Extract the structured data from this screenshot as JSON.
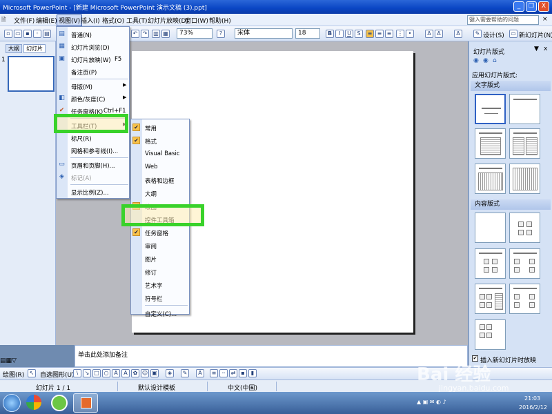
{
  "window": {
    "title": "Microsoft PowerPoint - [新建 Microsoft PowerPoint 演示文稿 (3).ppt]",
    "minimize_label": "_",
    "restore_label": "❐",
    "close_label": "X"
  },
  "menubar": {
    "items": [
      "文件(F)",
      "编辑(E)",
      "视图(V)",
      "插入(I)",
      "格式(O)",
      "工具(T)",
      "幻灯片放映(D)",
      "窗口(W)",
      "帮助(H)"
    ],
    "help_placeholder": "键入需要帮助的问题"
  },
  "toolbar": {
    "zoom": "73%",
    "font": "宋体",
    "font_size": "18",
    "bold": "B",
    "italic": "I",
    "underline": "U",
    "strike": "S",
    "design_label": "设计(S)",
    "new_slide_label": "新幻灯片(N)"
  },
  "left_pane": {
    "tabs": [
      "大纲",
      "幻灯片"
    ],
    "slide_number": "1"
  },
  "view_menu": {
    "items": [
      {
        "label": "普通(N)",
        "shortcut": "",
        "arrow": false,
        "disabled": false,
        "icon": "normal-view-icon",
        "glyph": "▤"
      },
      {
        "label": "幻灯片浏览(D)",
        "shortcut": "",
        "arrow": false,
        "disabled": false,
        "icon": "slide-sorter-icon",
        "glyph": "▦"
      },
      {
        "label": "幻灯片放映(W)",
        "shortcut": "F5",
        "arrow": false,
        "disabled": false,
        "icon": "slideshow-icon",
        "glyph": "▣"
      },
      {
        "label": "备注页(P)",
        "shortcut": "",
        "arrow": false,
        "disabled": false,
        "icon": "",
        "glyph": ""
      },
      {
        "label": "母版(M)",
        "shortcut": "",
        "arrow": true,
        "disabled": false,
        "icon": "",
        "glyph": ""
      },
      {
        "label": "颜色/灰度(C)",
        "shortcut": "",
        "arrow": true,
        "disabled": false,
        "icon": "color-icon",
        "glyph": "◧"
      },
      {
        "label": "任务窗格(K)",
        "shortcut": "Ctrl+F1",
        "arrow": false,
        "disabled": false,
        "icon": "check-icon",
        "glyph": "✔"
      },
      {
        "label": "工具栏(T)",
        "shortcut": "",
        "arrow": true,
        "disabled": false,
        "icon": "",
        "glyph": ""
      },
      {
        "label": "标尺(R)",
        "shortcut": "",
        "arrow": false,
        "disabled": false,
        "icon": "",
        "glyph": ""
      },
      {
        "label": "网格和参考线(I)...",
        "shortcut": "",
        "arrow": false,
        "disabled": false,
        "icon": "",
        "glyph": ""
      },
      {
        "label": "页眉和页脚(H)...",
        "shortcut": "",
        "arrow": false,
        "disabled": false,
        "icon": "header-icon",
        "glyph": "▭"
      },
      {
        "label": "标记(A)",
        "shortcut": "",
        "arrow": false,
        "disabled": true,
        "icon": "markup-icon",
        "glyph": "◈"
      },
      {
        "label": "显示比例(Z)...",
        "shortcut": "",
        "arrow": false,
        "disabled": false,
        "icon": "",
        "glyph": ""
      }
    ]
  },
  "toolbars_submenu": {
    "items": [
      {
        "label": "常用",
        "checked": true
      },
      {
        "label": "格式",
        "checked": true
      },
      {
        "label": "Visual Basic",
        "checked": false
      },
      {
        "label": "Web",
        "checked": false
      },
      {
        "label": "表格和边框",
        "checked": false
      },
      {
        "label": "大纲",
        "checked": false
      },
      {
        "label": "绘图",
        "checked": true
      },
      {
        "label": "控件工具箱",
        "checked": false
      },
      {
        "label": "任务窗格",
        "checked": true
      },
      {
        "label": "审阅",
        "checked": false
      },
      {
        "label": "图片",
        "checked": false
      },
      {
        "label": "修订",
        "checked": false
      },
      {
        "label": "艺术字",
        "checked": false
      },
      {
        "label": "符号栏",
        "checked": false
      },
      {
        "label": "自定义(C)...",
        "checked": false
      }
    ]
  },
  "task_pane": {
    "title": "幻灯片版式",
    "close_label": "x",
    "apply_label": "应用幻灯片版式:",
    "section_text": "文字版式",
    "section_content": "内容版式",
    "insert_checkbox_label": "插入新幻灯片时放映"
  },
  "notes": {
    "placeholder": "单击此处添加备注"
  },
  "drawbar": {
    "draw_label": "绘图(R)",
    "autoshape_label": "自选图形(U)"
  },
  "statusbar": {
    "slide_info": "幻灯片 1 / 1",
    "design": "默认设计模板",
    "language": "中文(中国)"
  },
  "taskbar": {
    "time": "21:03",
    "date": "2016/2/12"
  },
  "watermark": {
    "text": "Bai 经验",
    "url": "jingyan.baidu.com"
  }
}
